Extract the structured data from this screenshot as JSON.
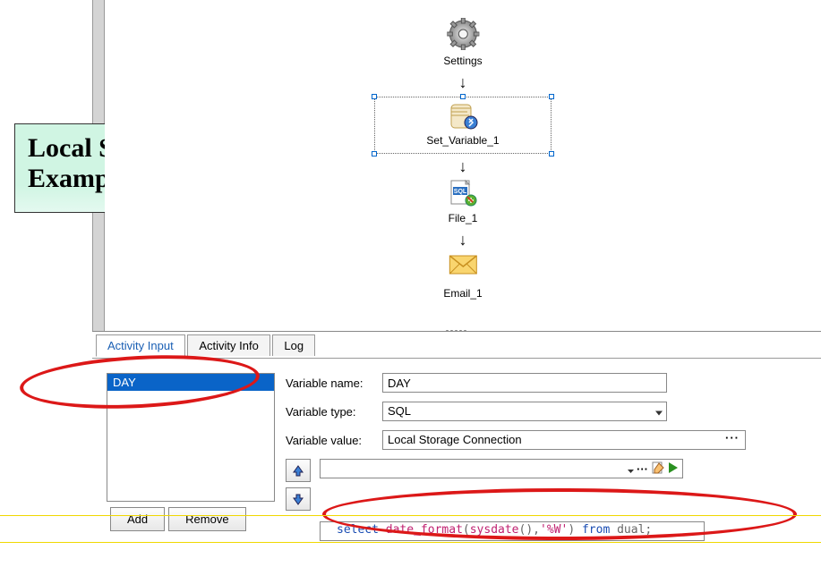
{
  "callout": {
    "line1": "Local Storage",
    "line2": "Example"
  },
  "flow": {
    "settings": "Settings",
    "set_variable": "Set_Variable_1",
    "file": "File_1",
    "email": "Email_1"
  },
  "tabs": {
    "activity_input": "Activity Input",
    "activity_info": "Activity Info",
    "log": "Log"
  },
  "var_list": {
    "items": [
      "DAY"
    ]
  },
  "buttons": {
    "add": "Add",
    "remove": "Remove"
  },
  "form": {
    "name_label": "Variable name:",
    "name_value": "DAY",
    "type_label": "Variable type:",
    "type_value": "SQL",
    "value_label": "Variable value:",
    "value_value": "Local Storage Connection"
  },
  "sql": {
    "kw_select": "select",
    "fn_date_format": "date_format",
    "fn_sysdate": "sysdate",
    "str_fmt": "'%W'",
    "kw_from": "from",
    "tbl": "dual"
  }
}
